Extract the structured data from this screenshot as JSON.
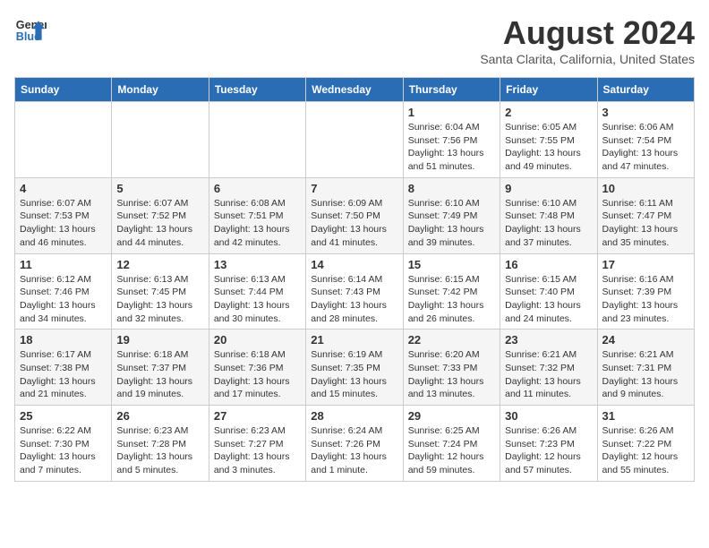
{
  "header": {
    "logo_line1": "General",
    "logo_line2": "Blue",
    "month_year": "August 2024",
    "location": "Santa Clarita, California, United States"
  },
  "weekdays": [
    "Sunday",
    "Monday",
    "Tuesday",
    "Wednesday",
    "Thursday",
    "Friday",
    "Saturday"
  ],
  "weeks": [
    [
      {
        "day": "",
        "info": ""
      },
      {
        "day": "",
        "info": ""
      },
      {
        "day": "",
        "info": ""
      },
      {
        "day": "",
        "info": ""
      },
      {
        "day": "1",
        "info": "Sunrise: 6:04 AM\nSunset: 7:56 PM\nDaylight: 13 hours\nand 51 minutes."
      },
      {
        "day": "2",
        "info": "Sunrise: 6:05 AM\nSunset: 7:55 PM\nDaylight: 13 hours\nand 49 minutes."
      },
      {
        "day": "3",
        "info": "Sunrise: 6:06 AM\nSunset: 7:54 PM\nDaylight: 13 hours\nand 47 minutes."
      }
    ],
    [
      {
        "day": "4",
        "info": "Sunrise: 6:07 AM\nSunset: 7:53 PM\nDaylight: 13 hours\nand 46 minutes."
      },
      {
        "day": "5",
        "info": "Sunrise: 6:07 AM\nSunset: 7:52 PM\nDaylight: 13 hours\nand 44 minutes."
      },
      {
        "day": "6",
        "info": "Sunrise: 6:08 AM\nSunset: 7:51 PM\nDaylight: 13 hours\nand 42 minutes."
      },
      {
        "day": "7",
        "info": "Sunrise: 6:09 AM\nSunset: 7:50 PM\nDaylight: 13 hours\nand 41 minutes."
      },
      {
        "day": "8",
        "info": "Sunrise: 6:10 AM\nSunset: 7:49 PM\nDaylight: 13 hours\nand 39 minutes."
      },
      {
        "day": "9",
        "info": "Sunrise: 6:10 AM\nSunset: 7:48 PM\nDaylight: 13 hours\nand 37 minutes."
      },
      {
        "day": "10",
        "info": "Sunrise: 6:11 AM\nSunset: 7:47 PM\nDaylight: 13 hours\nand 35 minutes."
      }
    ],
    [
      {
        "day": "11",
        "info": "Sunrise: 6:12 AM\nSunset: 7:46 PM\nDaylight: 13 hours\nand 34 minutes."
      },
      {
        "day": "12",
        "info": "Sunrise: 6:13 AM\nSunset: 7:45 PM\nDaylight: 13 hours\nand 32 minutes."
      },
      {
        "day": "13",
        "info": "Sunrise: 6:13 AM\nSunset: 7:44 PM\nDaylight: 13 hours\nand 30 minutes."
      },
      {
        "day": "14",
        "info": "Sunrise: 6:14 AM\nSunset: 7:43 PM\nDaylight: 13 hours\nand 28 minutes."
      },
      {
        "day": "15",
        "info": "Sunrise: 6:15 AM\nSunset: 7:42 PM\nDaylight: 13 hours\nand 26 minutes."
      },
      {
        "day": "16",
        "info": "Sunrise: 6:15 AM\nSunset: 7:40 PM\nDaylight: 13 hours\nand 24 minutes."
      },
      {
        "day": "17",
        "info": "Sunrise: 6:16 AM\nSunset: 7:39 PM\nDaylight: 13 hours\nand 23 minutes."
      }
    ],
    [
      {
        "day": "18",
        "info": "Sunrise: 6:17 AM\nSunset: 7:38 PM\nDaylight: 13 hours\nand 21 minutes."
      },
      {
        "day": "19",
        "info": "Sunrise: 6:18 AM\nSunset: 7:37 PM\nDaylight: 13 hours\nand 19 minutes."
      },
      {
        "day": "20",
        "info": "Sunrise: 6:18 AM\nSunset: 7:36 PM\nDaylight: 13 hours\nand 17 minutes."
      },
      {
        "day": "21",
        "info": "Sunrise: 6:19 AM\nSunset: 7:35 PM\nDaylight: 13 hours\nand 15 minutes."
      },
      {
        "day": "22",
        "info": "Sunrise: 6:20 AM\nSunset: 7:33 PM\nDaylight: 13 hours\nand 13 minutes."
      },
      {
        "day": "23",
        "info": "Sunrise: 6:21 AM\nSunset: 7:32 PM\nDaylight: 13 hours\nand 11 minutes."
      },
      {
        "day": "24",
        "info": "Sunrise: 6:21 AM\nSunset: 7:31 PM\nDaylight: 13 hours\nand 9 minutes."
      }
    ],
    [
      {
        "day": "25",
        "info": "Sunrise: 6:22 AM\nSunset: 7:30 PM\nDaylight: 13 hours\nand 7 minutes."
      },
      {
        "day": "26",
        "info": "Sunrise: 6:23 AM\nSunset: 7:28 PM\nDaylight: 13 hours\nand 5 minutes."
      },
      {
        "day": "27",
        "info": "Sunrise: 6:23 AM\nSunset: 7:27 PM\nDaylight: 13 hours\nand 3 minutes."
      },
      {
        "day": "28",
        "info": "Sunrise: 6:24 AM\nSunset: 7:26 PM\nDaylight: 13 hours\nand 1 minute."
      },
      {
        "day": "29",
        "info": "Sunrise: 6:25 AM\nSunset: 7:24 PM\nDaylight: 12 hours\nand 59 minutes."
      },
      {
        "day": "30",
        "info": "Sunrise: 6:26 AM\nSunset: 7:23 PM\nDaylight: 12 hours\nand 57 minutes."
      },
      {
        "day": "31",
        "info": "Sunrise: 6:26 AM\nSunset: 7:22 PM\nDaylight: 12 hours\nand 55 minutes."
      }
    ]
  ]
}
